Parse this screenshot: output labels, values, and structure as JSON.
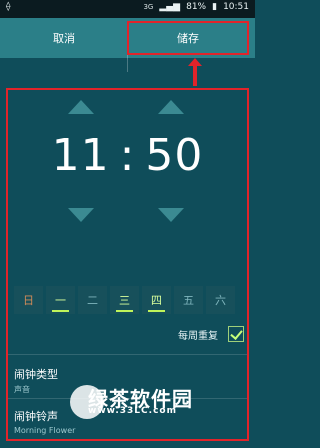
{
  "status_bar": {
    "left_icon": "usb-icon",
    "signal_text": "3G",
    "battery_percent": "81%",
    "time": "10:51"
  },
  "top_bar": {
    "cancel_label": "取消",
    "save_label": "储存"
  },
  "alarm": {
    "hour": "11",
    "minute": "50"
  },
  "days": [
    {
      "label": "日",
      "active": false,
      "sun": true
    },
    {
      "label": "一",
      "active": true,
      "sun": false
    },
    {
      "label": "二",
      "active": false,
      "sun": false
    },
    {
      "label": "三",
      "active": true,
      "sun": false
    },
    {
      "label": "四",
      "active": true,
      "sun": false
    },
    {
      "label": "五",
      "active": false,
      "sun": false
    },
    {
      "label": "六",
      "active": false,
      "sun": false
    }
  ],
  "repeat": {
    "label": "每周重复",
    "checked": true
  },
  "settings": [
    {
      "title": "闹钟类型",
      "subtitle": "声音"
    },
    {
      "title": "闹钟铃声",
      "subtitle": "Morning Flower"
    }
  ],
  "watermark": {
    "brand": "绿茶软件园",
    "url": "www.33LC.com"
  },
  "colors": {
    "highlight_red": "#e2242a",
    "topbar_teal": "#2b7f88",
    "background": "#0f4d5a",
    "active_green": "#bff35a"
  }
}
